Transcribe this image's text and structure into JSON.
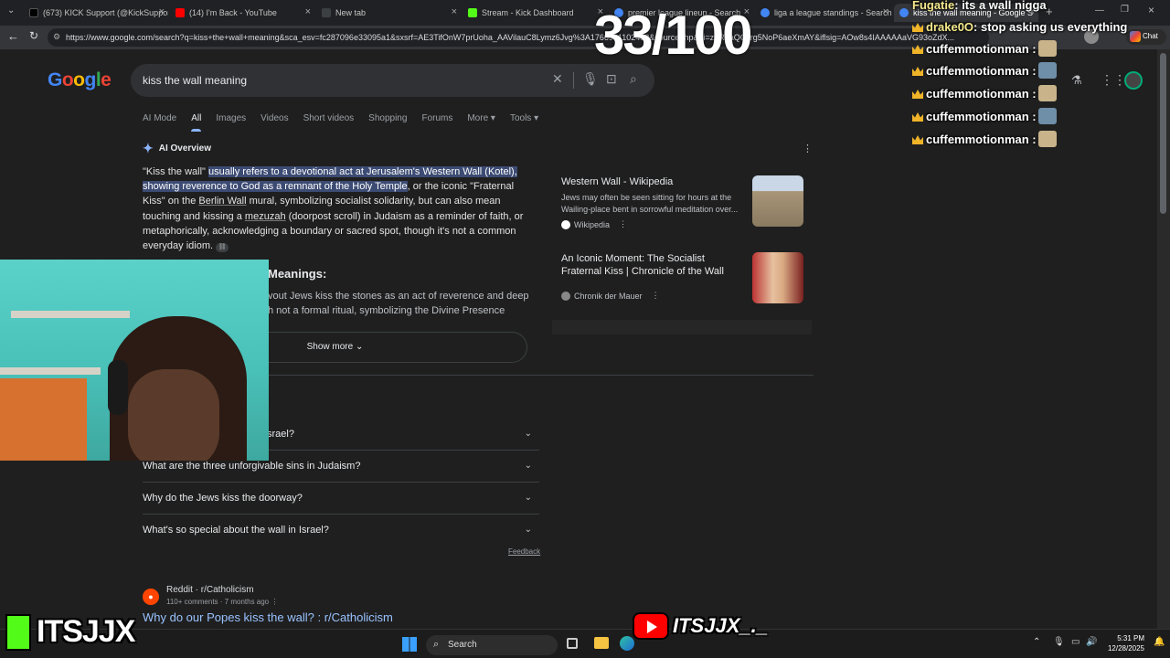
{
  "browser": {
    "tabs": [
      {
        "label": "(673) KICK Support (@KickSuppor",
        "color": "#000000"
      },
      {
        "label": "(14) I'm Back - YouTube",
        "color": "#ff0000"
      },
      {
        "label": "New tab",
        "color": "#3c4043"
      },
      {
        "label": "Stream - Kick Dashboard",
        "color": "#53fc18"
      },
      {
        "label": "premier league lineup - Search",
        "color": "#4285f4"
      },
      {
        "label": "liga a league standings - Search",
        "color": "#4285f4"
      },
      {
        "label": "kiss the wall meaning - Google S",
        "color": "#4285f4"
      }
    ],
    "url": "https://www.google.com/search?q=kiss+the+wall+meaning&sca_esv=fc287096e33095a1&sxsrf=AE3TifOnW7prUoha_AAVilauC8Lymz6Jvg%3A1766961102438&source=hp&ei=zdRaaQCJrg5NoP6aeXmAY&iflsig=AOw8s4IAAAAAaVG93oZdX...",
    "new_tab_symbol": "+",
    "chat_label": "Chat"
  },
  "google": {
    "logo": "Google",
    "query": "kiss the wall meaning",
    "nav_tabs": [
      "AI Mode",
      "All",
      "Images",
      "Videos",
      "Short videos",
      "Shopping",
      "Forums",
      "More",
      "Tools"
    ],
    "ai_overview_label": "AI Overview",
    "ai_paragraph": {
      "p1": "\"Kiss the wall\" ",
      "p2": "usually refers to a devotional act at Jerusalem's Western Wall (Kotel), showing reverence to God as a remnant of the Holy Temple",
      "p3": ", or the iconic \"Fraternal Kiss\" on the ",
      "p4": "Berlin Wall",
      "p5": " mural, symbolizing socialist solidarity, but can also mean touching and kissing a ",
      "p6": "mezuzah",
      "p7": " (doorpost scroll) in Judaism as a reminder of faith, or metaphorically, acknowledging a boundary or sacred spot, though it's not a common everyday idiom."
    },
    "ai_subheading": "Meanings:",
    "ai_sub_text": "vout Jews kiss the stones as an act of reverence and deep h not a formal ritual, symbolizing the Divine Presence",
    "show_more": "Show more",
    "sources": [
      {
        "title": "Western Wall - Wikipedia",
        "snippet": "Jews may often be seen sitting for hours at the Wailing-place bent in sorrowful meditation over...",
        "site": "Wikipedia"
      },
      {
        "title": "An Iconic Moment: The Socialist Fraternal Kiss | Chronicle of the Wall",
        "snippet": "",
        "site": "Chronik der Mauer"
      }
    ],
    "faqs": [
      "srael?",
      "What are the three unforgivable sins in Judaism?",
      "Why do the Jews kiss the doorway?",
      "What's so special about the wall in Israel?"
    ],
    "feedback": "Feedback",
    "result": {
      "site": "Reddit · r/Catholicism",
      "meta": "110+ comments · 7 months ago",
      "title": "Why do our Popes kiss the wall? : r/Catholicism"
    }
  },
  "overlay": {
    "counter": "33/100",
    "chat": [
      {
        "name": "Fugatie",
        "message": "its a wall nigga"
      },
      {
        "name": "drake0O",
        "message": "stop asking us everything"
      },
      {
        "name": "cuffemmotionman",
        "message": ""
      },
      {
        "name": "cuffemmotionman",
        "message": ""
      },
      {
        "name": "cuffemmotionman",
        "message": ""
      },
      {
        "name": "cuffemmotionman",
        "message": ""
      },
      {
        "name": "cuffemmotionman",
        "message": ""
      }
    ],
    "kick_name": "ITSJJX",
    "yt_name": "ITSJJX_._"
  },
  "taskbar": {
    "search_label": "Search",
    "time": "5:31 PM",
    "date": "12/28/2025"
  }
}
